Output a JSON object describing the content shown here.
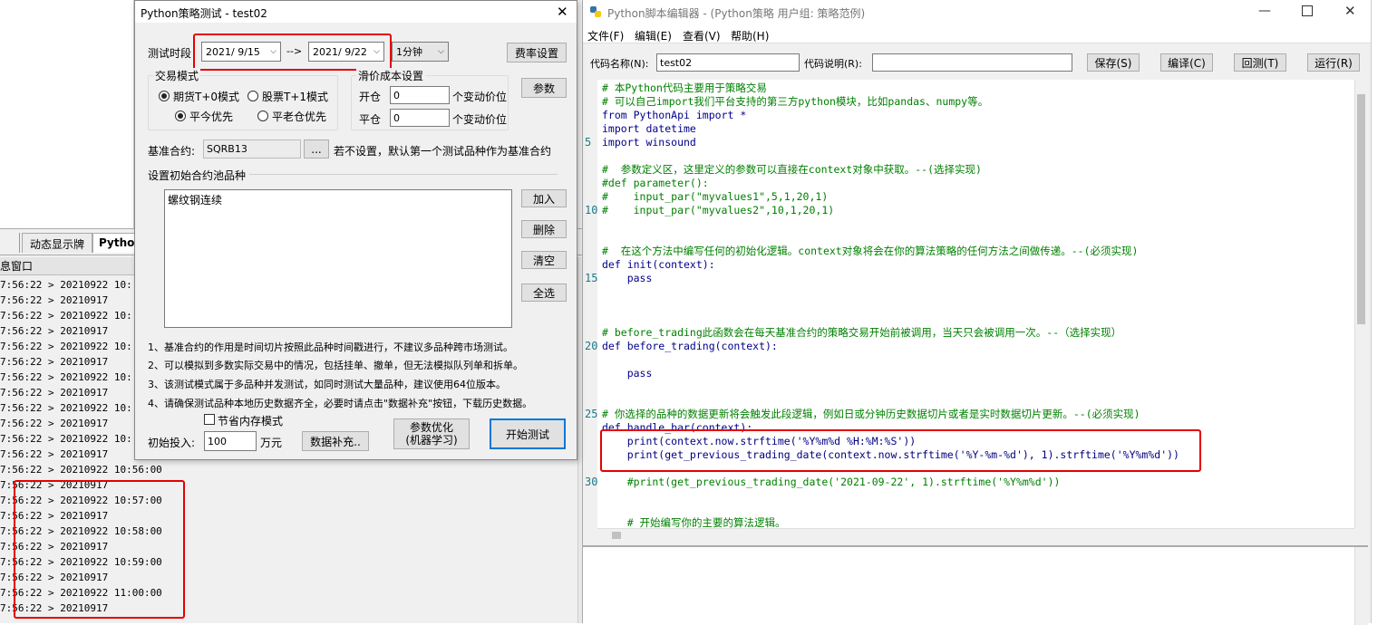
{
  "log": {
    "tabs": [
      "动态显示牌",
      "Python"
    ],
    "panel_title": "息窗口",
    "lines": [
      "7:56:22 > 20210922 10:",
      "7:56:22 > 20210917",
      "7:56:22 > 20210922 10:",
      "7:56:22 > 20210917",
      "7:56:22 > 20210922 10:",
      "7:56:22 > 20210917",
      "7:56:22 > 20210922 10:",
      "7:56:22 > 20210917",
      "7:56:22 > 20210922 10:",
      "7:56:22 > 20210917",
      "7:56:22 > 20210922 10:",
      "7:56:22 > 20210917",
      "7:56:22 > 20210922 10:56:00",
      "7:56:22 > 20210917",
      "7:56:22 > 20210922 10:57:00",
      "7:56:22 > 20210917",
      "7:56:22 > 20210922 10:58:00",
      "7:56:22 > 20210917",
      "7:56:22 > 20210922 10:59:00",
      "7:56:22 > 20210917",
      "7:56:22 > 20210922 11:00:00",
      "7:56:22 > 20210917"
    ]
  },
  "dialog": {
    "title": "Python策略测试 - test02",
    "close": "✕",
    "test_period_label": "测试时段",
    "start_date": "2021/ 9/15",
    "arrow": "-->",
    "end_date": "2021/ 9/22",
    "period": "1分钟",
    "fee_button": "费率设置",
    "param_button": "参数",
    "trade_mode_title": "交易模式",
    "mode_futures": "期货T+0模式",
    "mode_stock": "股票T+1模式",
    "close_today": "平今优先",
    "close_old": "平老仓优先",
    "slippage_title": "滑价成本设置",
    "open_label": "开仓",
    "open_value": "0",
    "close_label": "平仓",
    "close_value": "0",
    "tick_unit": "个变动价位",
    "base_contract_label": "基准合约:",
    "base_contract_value": "SQRB13",
    "browse": "...",
    "base_hint": "若不设置，默认第一个测试品种作为基准合约",
    "pool_title": "设置初始合约池品种",
    "pool_items": [
      "螺纹钢连续"
    ],
    "add_button": "加入",
    "delete_button": "删除",
    "clear_button": "清空",
    "select_all_button": "全选",
    "notes": [
      "1、基准合约的作用是时间切片按照此品种时间戳进行，不建议多品种跨市场测试。",
      "2、可以模拟到多数实际交易中的情况，包括挂单、撤单，但无法模拟队列单和拆单。",
      "3、该测试模式属于多品种并发测试，如同时测试大量品种，建议使用64位版本。",
      "4、请确保测试品种本地历史数据齐全，必要时请点击\"数据补充\"按钮，下载历史数据。"
    ],
    "memory_mode": "节省内存模式",
    "initial_invest_label": "初始投入:",
    "initial_invest_value": "100",
    "unit_wan": "万元",
    "data_supplement_button": "数据补充..",
    "param_opt_line1": "参数优化",
    "param_opt_line2": "(机器学习)",
    "start_test_button": "开始测试"
  },
  "editor": {
    "title": "Python脚本编辑器 - (Python策略 用户组: 策略范例)",
    "menu": [
      "文件(F)",
      "编辑(E)",
      "查看(V)",
      "帮助(H)"
    ],
    "code_name_label": "代码名称(N):",
    "code_name_value": "test02",
    "code_desc_label": "代码说明(R):",
    "code_desc_value": "",
    "save_button": "保存(S)",
    "compile_button": "编译(C)",
    "backtest_button": "回测(T)",
    "run_button": "运行(R)",
    "line_numbers": [
      "5",
      "10",
      "15",
      "20",
      "25",
      "30"
    ],
    "code": [
      {
        "t": "# 本Python代码主要用于策略交易",
        "c": "cm"
      },
      {
        "t": "# 可以自己import我们平台支持的第三方python模块，比如pandas、numpy等。",
        "c": "cm"
      },
      {
        "t": "from PythonApi import *",
        "c": "kw"
      },
      {
        "t": "import datetime",
        "c": "kw"
      },
      {
        "t": "import winsound",
        "c": "kw"
      },
      {
        "t": "",
        "c": "tx"
      },
      {
        "t": "#  参数定义区，这里定义的参数可以直接在context对象中获取。--(选择实现)",
        "c": "cm"
      },
      {
        "t": "#def parameter():",
        "c": "cm"
      },
      {
        "t": "#    input_par(\"myvalues1\",5,1,20,1)",
        "c": "cm"
      },
      {
        "t": "#    input_par(\"myvalues2\",10,1,20,1)",
        "c": "cm"
      },
      {
        "t": "",
        "c": "tx"
      },
      {
        "t": "",
        "c": "tx"
      },
      {
        "t": "#  在这个方法中编写任何的初始化逻辑。context对象将会在你的算法策略的任何方法之间做传递。--(必须实现)",
        "c": "cm"
      },
      {
        "t": "def init(context):",
        "c": "kw"
      },
      {
        "t": "    pass",
        "c": "kw"
      },
      {
        "t": "",
        "c": "tx"
      },
      {
        "t": "",
        "c": "tx"
      },
      {
        "t": "",
        "c": "tx"
      },
      {
        "t": "# before_trading此函数会在每天基准合约的策略交易开始前被调用，当天只会被调用一次。--（选择实现）",
        "c": "cm"
      },
      {
        "t": "def before_trading(context):",
        "c": "kw"
      },
      {
        "t": "",
        "c": "tx"
      },
      {
        "t": "    pass",
        "c": "kw"
      },
      {
        "t": "",
        "c": "tx"
      },
      {
        "t": "",
        "c": "tx"
      },
      {
        "t": "# 你选择的品种的数据更新将会触发此段逻辑，例如日或分钟历史数据切片或者是实时数据切片更新。--(必须实现)",
        "c": "cm"
      },
      {
        "t": "def handle_bar(context):",
        "c": "kw"
      },
      {
        "t": "    print(context.now.strftime('%Y%m%d %H:%M:%S'))",
        "c": "tx"
      },
      {
        "t": "    print(get_previous_trading_date(context.now.strftime('%Y-%m-%d'), 1).strftime('%Y%m%d'))",
        "c": "tx"
      },
      {
        "t": "",
        "c": "tx"
      },
      {
        "t": "    #print(get_previous_trading_date('2021-09-22', 1).strftime('%Y%m%d'))",
        "c": "cm"
      },
      {
        "t": "",
        "c": "tx"
      },
      {
        "t": "",
        "c": "tx"
      },
      {
        "t": "    # 开始编写你的主要的算法逻辑。",
        "c": "cm"
      }
    ]
  },
  "colors": {
    "highlight": "#e60000",
    "comment": "#008000",
    "keyword": "#00008b"
  },
  "icons": [
    "python-icon",
    "minimize-icon",
    "maximize-icon",
    "close-icon"
  ]
}
